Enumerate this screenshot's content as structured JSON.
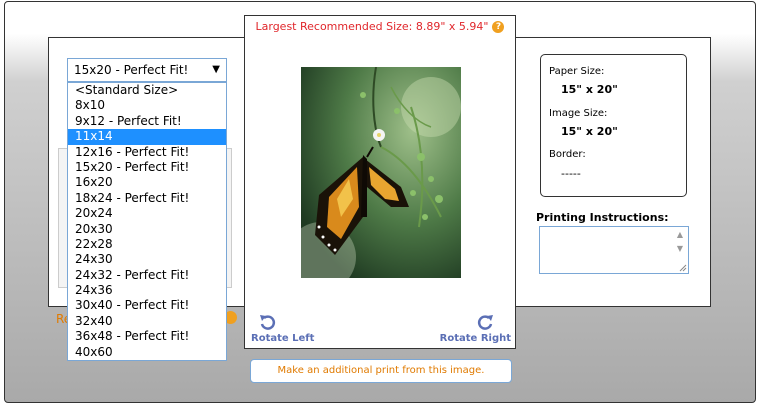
{
  "recommend": {
    "label": "Largest Recommended Size:  8.89\" x 5.94\"",
    "help_glyph": "?"
  },
  "size_select": {
    "value": "15x20 - Perfect Fit!",
    "caret": "▼",
    "options": [
      "<Standard Size>",
      "8x10",
      "9x12 - Perfect Fit!",
      "11x14",
      "12x16 - Perfect Fit!",
      "15x20 - Perfect Fit!",
      "16x20",
      "18x24 - Perfect Fit!",
      "20x24",
      "20x30",
      "22x28",
      "24x30",
      "24x32 - Perfect Fit!",
      "24x36",
      "30x40 - Perfect Fit!",
      "32x40",
      "36x48 - Perfect Fit!",
      "40x60"
    ],
    "highlighted": "11x14"
  },
  "behind": {
    "partial_text": "Re"
  },
  "rotate": {
    "left_label": "Rotate Left",
    "right_label": "Rotate Right"
  },
  "add_print": {
    "label": "Make an additional print from this image."
  },
  "info": {
    "paper_label": "Paper Size:",
    "paper_value": "15\" x 20\"",
    "image_label": "Image Size:",
    "image_value": "15\" x 20\"",
    "border_label": "Border:",
    "border_value": "-----"
  },
  "instructions": {
    "label": "Printing Instructions:",
    "value": ""
  },
  "colors": {
    "accent": "#1e90ff",
    "warning": "#e0262b",
    "link": "#5b6fb5",
    "orange": "#e07a00"
  }
}
